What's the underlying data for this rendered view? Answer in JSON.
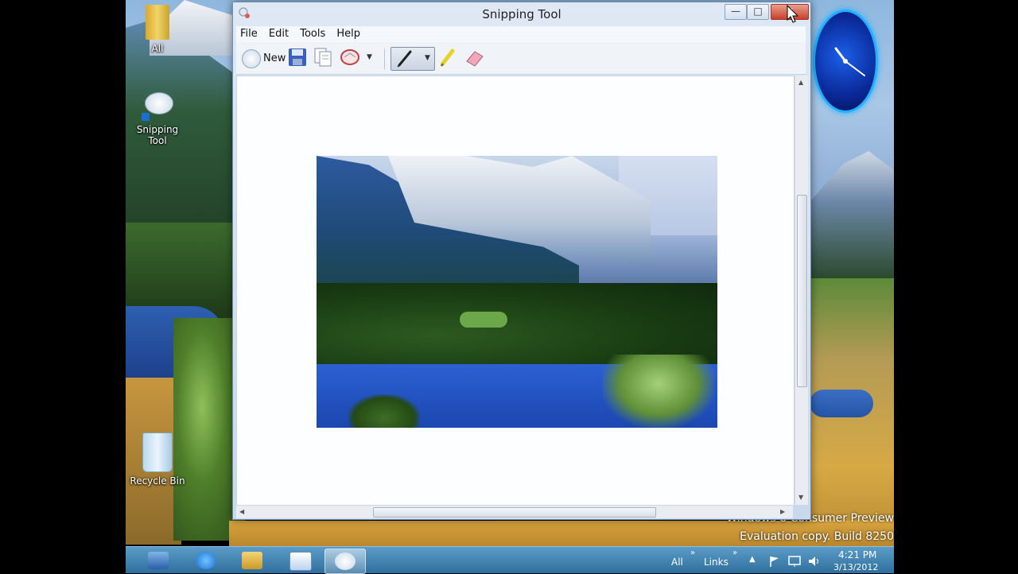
{
  "desktop": {
    "icons": [
      {
        "label": "All"
      },
      {
        "label_line1": "Snipping",
        "label_line2": "Tool"
      },
      {
        "label": "Recycle Bin"
      }
    ],
    "watermark_line1": "Windows 8 Consumer Preview",
    "watermark_line2": "Evaluation copy. Build 8250"
  },
  "window": {
    "title": "Snipping Tool",
    "caption_buttons": {
      "minimize": "—",
      "maximize": "□",
      "close": "✕"
    },
    "menu": [
      "File",
      "Edit",
      "Tools",
      "Help"
    ],
    "toolbar": {
      "new_label": "New",
      "tools": [
        "save-icon",
        "copy-icon",
        "send-snip-icon",
        "pen-icon",
        "highlighter-icon",
        "eraser-icon"
      ]
    }
  },
  "taskbar": {
    "apps": [
      "server-manager-icon",
      "internet-explorer-icon",
      "file-explorer-icon",
      "wordpad-icon",
      "snipping-tool-icon"
    ],
    "tray": {
      "all_label": "All",
      "links_label": "Links",
      "chevron": "»",
      "time": "4:21 PM",
      "date": "3/13/2012"
    }
  },
  "colors": {
    "taskbar": "#3a7fb0",
    "window_frame": "#c8d9ec",
    "close_button": "#c8402a"
  }
}
